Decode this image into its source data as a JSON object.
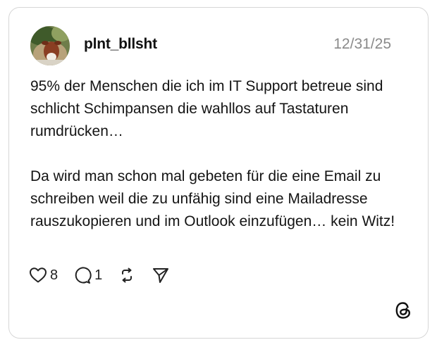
{
  "post": {
    "username": "plnt_bllsht",
    "timestamp": "12/31/25",
    "paragraphs": [
      "95% der Menschen die ich im IT Support betreue sind schlicht Schimpansen die wahllos auf Tastaturen rumdrücken…",
      "Da wird man schon mal gebeten für die eine Email zu schreiben weil die zu unfähig sind eine Mailadresse rauszukopieren und im Outlook einzufügen… kein Witz!"
    ]
  },
  "actions": {
    "like_icon": "heart-icon",
    "like_count": "8",
    "reply_icon": "comment-icon",
    "reply_count": "1",
    "repost_icon": "repost-icon",
    "share_icon": "send-icon"
  },
  "branding": {
    "logo_icon": "threads-logo-icon"
  }
}
